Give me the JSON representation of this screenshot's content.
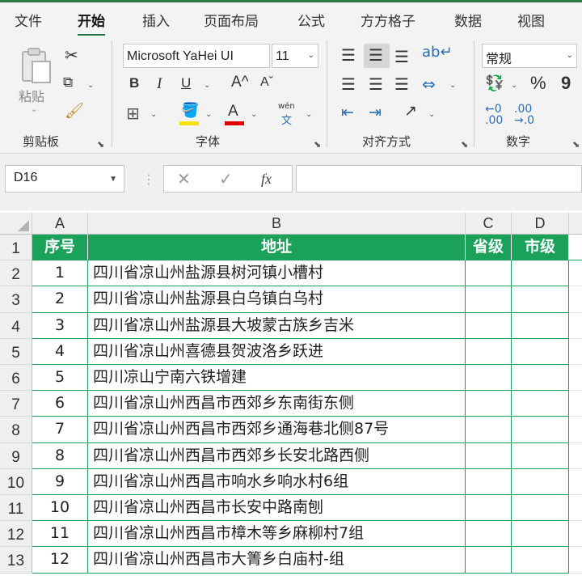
{
  "tabs": [
    "文件",
    "开始",
    "插入",
    "页面布局",
    "公式",
    "方方格子",
    "数据",
    "视图"
  ],
  "active_tab": "开始",
  "ribbon": {
    "clipboard": {
      "label": "剪贴板",
      "paste_label": "粘贴"
    },
    "font": {
      "label": "字体",
      "font_name": "Microsoft YaHei UI",
      "font_size": "11",
      "bold": "B",
      "italic": "I",
      "underline": "U",
      "grow": "A^",
      "shrink": "Aˇ",
      "font_color_glyph": "A",
      "phonetic_top": "wén",
      "phonetic_bottom": "文"
    },
    "alignment": {
      "label": "对齐方式"
    },
    "number": {
      "label": "数字",
      "format": "常规",
      "percent": "%",
      "comma": "9"
    }
  },
  "formula_bar": {
    "name_box": "D16",
    "fx": "fx",
    "formula": ""
  },
  "columns": [
    "A",
    "B",
    "C",
    "D"
  ],
  "header_row": {
    "row": "1",
    "cells": [
      "序号",
      "地址",
      "省级",
      "市级"
    ]
  },
  "rows": [
    {
      "row": "2",
      "no": "1",
      "address": "四川省凉山州盐源县树河镇小槽村"
    },
    {
      "row": "3",
      "no": "2",
      "address": "四川省凉山州盐源县白乌镇白乌村"
    },
    {
      "row": "4",
      "no": "3",
      "address": "四川省凉山州盐源县大坡蒙古族乡吉米"
    },
    {
      "row": "5",
      "no": "4",
      "address": "四川省凉山州喜德县贺波洛乡跃进"
    },
    {
      "row": "6",
      "no": "5",
      "address": "四川凉山宁南六铁增建"
    },
    {
      "row": "7",
      "no": "6",
      "address": "四川省凉山州西昌市西郊乡东南街东侧"
    },
    {
      "row": "8",
      "no": "7",
      "address": "四川省凉山州西昌市西郊乡通海巷北侧87号"
    },
    {
      "row": "9",
      "no": "8",
      "address": "四川省凉山州西昌市西郊乡长安北路西侧"
    },
    {
      "row": "10",
      "no": "9",
      "address": "四川省凉山州西昌市响水乡响水村6组"
    },
    {
      "row": "11",
      "no": "10",
      "address": "四川省凉山州西昌市长安中路南刨"
    },
    {
      "row": "12",
      "no": "11",
      "address": "四川省凉山州西昌市樟木等乡麻柳村7组"
    },
    {
      "row": "13",
      "no": "12",
      "address": "四川省凉山州西昌市大箐乡白庙村-组"
    }
  ],
  "colors": {
    "accent": "#1e7145",
    "table_header": "#1aa15a",
    "border": "#19a05a"
  }
}
